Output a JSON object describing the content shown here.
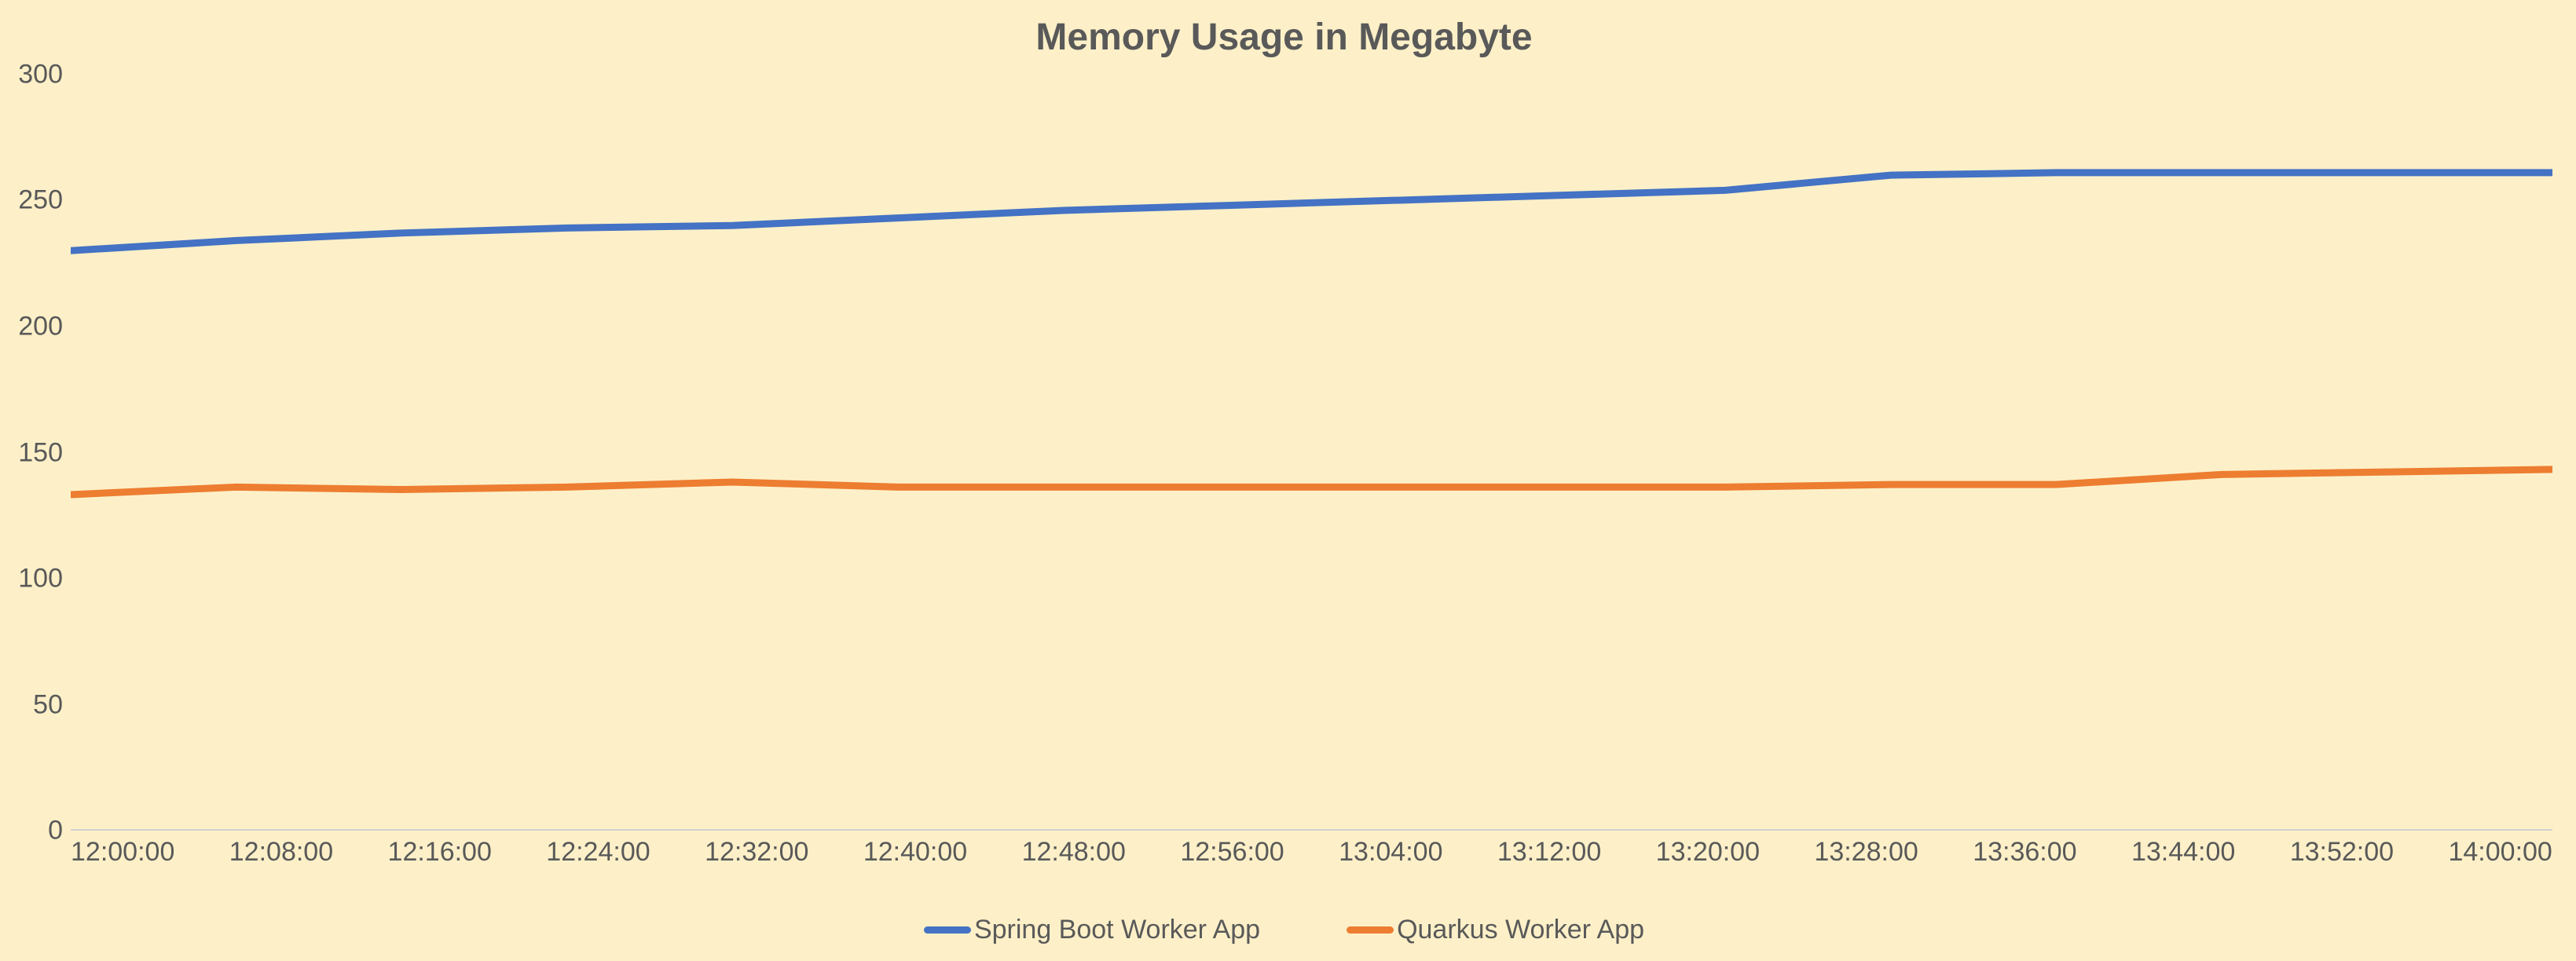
{
  "chart_data": {
    "type": "line",
    "title": "Memory Usage in Megabyte",
    "xlabel": "",
    "ylabel": "",
    "ylim": [
      0,
      300
    ],
    "yticks": [
      0,
      50,
      100,
      150,
      200,
      250,
      300
    ],
    "categories": [
      "12:00:00",
      "12:08:00",
      "12:16:00",
      "12:24:00",
      "12:32:00",
      "12:40:00",
      "12:48:00",
      "12:56:00",
      "13:04:00",
      "13:12:00",
      "13:20:00",
      "13:28:00",
      "13:36:00",
      "13:44:00",
      "13:52:00",
      "14:00:00"
    ],
    "xtick_labels": [
      "12:00:00",
      "12:08:00",
      "12:16:00",
      "12:24:00",
      "12:32:00",
      "12:40:00",
      "12:48:00",
      "12:56:00",
      "13:04:00",
      "13:12:00",
      "13:20:00",
      "13:28:00",
      "13:36:00",
      "13:44:00",
      "13:52:00",
      "14:00:00"
    ],
    "series": [
      {
        "name": "Spring Boot Worker App",
        "color": "#4472c4",
        "values": [
          230,
          234,
          237,
          239,
          240,
          243,
          246,
          248,
          250,
          252,
          254,
          260,
          261,
          261,
          261,
          261
        ]
      },
      {
        "name": "Quarkus Worker App",
        "color": "#ed7d31",
        "values": [
          133,
          136,
          135,
          136,
          138,
          136,
          136,
          136,
          136,
          136,
          136,
          137,
          137,
          141,
          142,
          143
        ]
      }
    ],
    "legend_position": "bottom",
    "grid": false
  }
}
